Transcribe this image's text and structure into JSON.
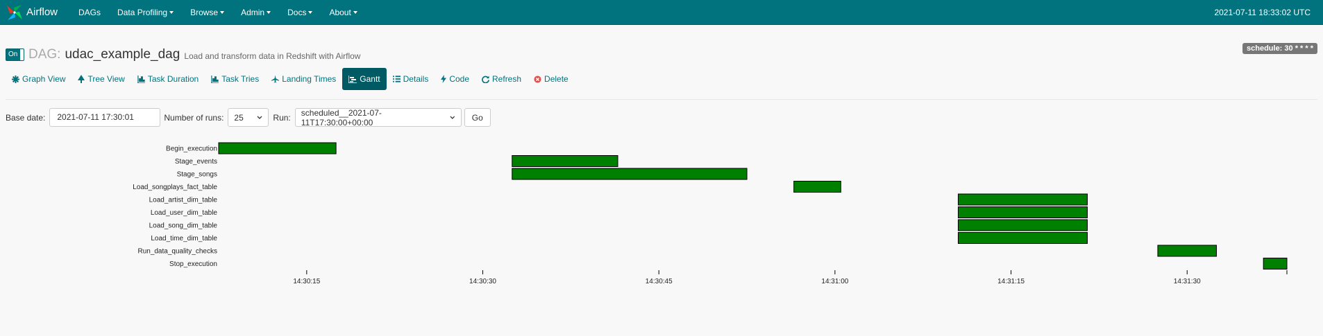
{
  "navbar": {
    "brand": "Airflow",
    "menu": [
      {
        "label": "DAGs",
        "dropdown": false
      },
      {
        "label": "Data Profiling",
        "dropdown": true
      },
      {
        "label": "Browse",
        "dropdown": true
      },
      {
        "label": "Admin",
        "dropdown": true
      },
      {
        "label": "Docs",
        "dropdown": true
      },
      {
        "label": "About",
        "dropdown": true
      }
    ],
    "clock": "2021-07-11 18:33:02 UTC",
    "color": "#00737f"
  },
  "dag": {
    "toggle_label": "On",
    "label": "DAG:",
    "id": "udac_example_dag",
    "description": "Load and transform data in Redshift with Airflow",
    "schedule": "schedule: 30 * * * *"
  },
  "tabs": [
    {
      "label": "Graph View",
      "icon": "asterisk-icon",
      "active": false
    },
    {
      "label": "Tree View",
      "icon": "tree-icon",
      "active": false
    },
    {
      "label": "Task Duration",
      "icon": "bar-chart-icon",
      "active": false
    },
    {
      "label": "Task Tries",
      "icon": "bar-chart-icon",
      "active": false
    },
    {
      "label": "Landing Times",
      "icon": "plane-icon",
      "active": false
    },
    {
      "label": "Gantt",
      "icon": "gantt-icon",
      "active": true
    },
    {
      "label": "Details",
      "icon": "list-icon",
      "active": false
    },
    {
      "label": "Code",
      "icon": "flash-icon",
      "active": false
    },
    {
      "label": "Refresh",
      "icon": "refresh-icon",
      "active": false
    },
    {
      "label": "Delete",
      "icon": "remove-circle-icon",
      "active": false
    }
  ],
  "form": {
    "base_date_label": "Base date:",
    "base_date_value": "2021-07-11 17:30:01",
    "num_runs_label": "Number of runs:",
    "num_runs_value": "25",
    "run_label": "Run:",
    "run_value": "scheduled__2021-07-11T17:30:00+00:00",
    "go_label": "Go"
  },
  "chart_data": {
    "type": "gantt",
    "bar_color": "#008000",
    "x_domain_seconds": [
      7.5,
      98.5
    ],
    "tick_labels": [
      "14:30:15",
      "14:30:30",
      "14:30:45",
      "14:31:00",
      "14:31:15",
      "14:31:30"
    ],
    "tick_seconds": [
      15,
      30,
      45,
      60,
      75,
      90
    ],
    "tasks": [
      {
        "name": "Begin_execution",
        "start": 7.5,
        "end": 17.5
      },
      {
        "name": "Stage_events",
        "start": 32.5,
        "end": 41.5
      },
      {
        "name": "Stage_songs",
        "start": 32.5,
        "end": 52.5
      },
      {
        "name": "Load_songplays_fact_table",
        "start": 56.5,
        "end": 60.5
      },
      {
        "name": "Load_artist_dim_table",
        "start": 70.5,
        "end": 81.5
      },
      {
        "name": "Load_user_dim_table",
        "start": 70.5,
        "end": 81.5
      },
      {
        "name": "Load_song_dim_table",
        "start": 70.5,
        "end": 81.5
      },
      {
        "name": "Load_time_dim_table",
        "start": 70.5,
        "end": 81.5
      },
      {
        "name": "Run_data_quality_checks",
        "start": 87.5,
        "end": 92.5
      },
      {
        "name": "Stop_execution",
        "start": 96.5,
        "end": 98.5
      }
    ]
  }
}
